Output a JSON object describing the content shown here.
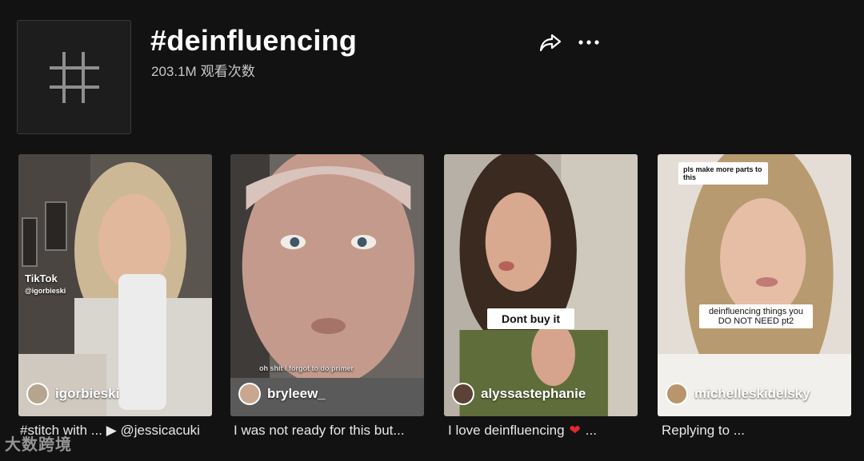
{
  "header": {
    "title": "#deinfluencing",
    "views_value": "203.1M",
    "views_label": "观看次数"
  },
  "videos": [
    {
      "author": "igorbieski",
      "caption": "#stitch with ... ▶ @jessicacuki",
      "overlay": "TikTok",
      "overlay_sub": "@igorbieski"
    },
    {
      "author": "bryleew_",
      "caption": "I was not ready for this but...",
      "overlay": "oh shit I forgot to do primer"
    },
    {
      "author": "alyssastephanie",
      "caption_before": "I love deinfluencing",
      "caption_after": "...",
      "overlay": "Dont buy it"
    },
    {
      "author": "michelleskidelsky",
      "caption": "Replying to ...",
      "overlay": "deinfluencing things you DO NOT NEED pt2",
      "comment": "pls make more parts to this"
    }
  ],
  "watermark": "大数跨境",
  "colors": {
    "background": "#121212",
    "heart": "#e0282f"
  }
}
